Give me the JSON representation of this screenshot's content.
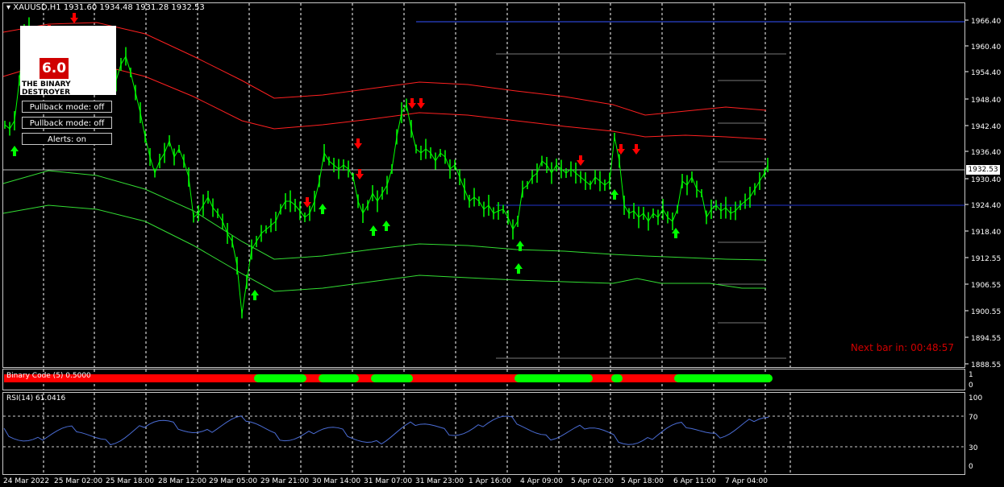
{
  "header": {
    "symbol_info": "XAUUSD,H1  1931.60 1934.48 1931.28 1932.53"
  },
  "panel": {
    "logo_version": "6.0",
    "logo_text": "THE BINARY DESTROYER",
    "buttons": [
      "Pullback mode: off",
      "Pullback mode: off",
      "Alerts: on"
    ]
  },
  "next_bar": "Next bar in: 00:48:57",
  "price_axis": [
    "1966.40",
    "1960.40",
    "1954.40",
    "1948.40",
    "1942.40",
    "1936.40",
    "1930.40",
    "1924.40",
    "1918.40",
    "1912.55",
    "1906.55",
    "1900.55",
    "1894.55",
    "1888.55"
  ],
  "current_price": "1932.53",
  "indicator": {
    "label": "Binary Code (5) 0.5000",
    "axis": [
      "1",
      "0"
    ]
  },
  "rsi": {
    "label": "RSI(14) 61.0416",
    "axis": [
      "100",
      "70",
      "30",
      "0"
    ]
  },
  "time_axis": [
    "24 Mar 2022",
    "25 Mar 02:00",
    "25 Mar 18:00",
    "28 Mar 12:00",
    "29 Mar 05:00",
    "29 Mar 21:00",
    "30 Mar 14:00",
    "31 Mar 07:00",
    "31 Mar 23:00",
    "1 Apr 16:00",
    "4 Apr 09:00",
    "5 Apr 02:00",
    "5 Apr 18:00",
    "6 Apr 11:00",
    "7 Apr 04:00"
  ],
  "colors": {
    "bull": "#00ff00",
    "bear": "#ff0000",
    "grid": "#ffffff",
    "rsi": "#4a6cd4",
    "band_red": "#ff2020",
    "band_green": "#33dd33"
  }
}
